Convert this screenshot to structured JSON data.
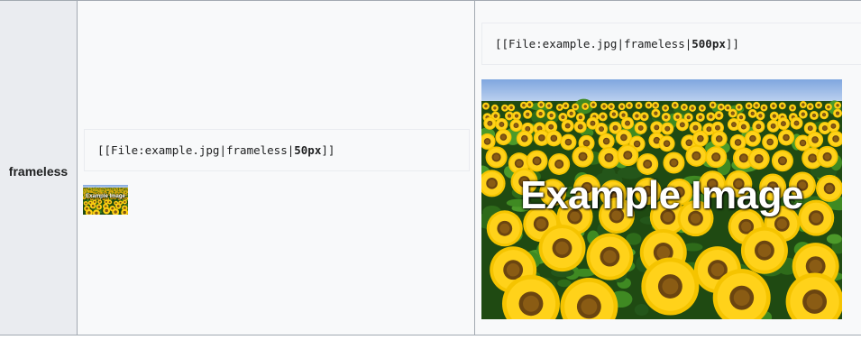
{
  "table": {
    "row_header": "frameless",
    "cell_small": {
      "code_prefix": "[[File:example.jpg|frameless|",
      "code_bold": "50px",
      "code_suffix": "]]",
      "image_caption_text": "Example Image",
      "image_icon": "sunflower-field-image"
    },
    "cell_large": {
      "code_prefix": "[[File:example.jpg|frameless|",
      "code_bold": "500px",
      "code_suffix": "]]",
      "image_caption_text": "Example Image",
      "image_icon": "sunflower-field-image"
    }
  },
  "colors": {
    "header_bg": "#eaecf0",
    "cell_bg": "#f8f9fa",
    "border": "#a2a9b1",
    "text": "#202122"
  }
}
